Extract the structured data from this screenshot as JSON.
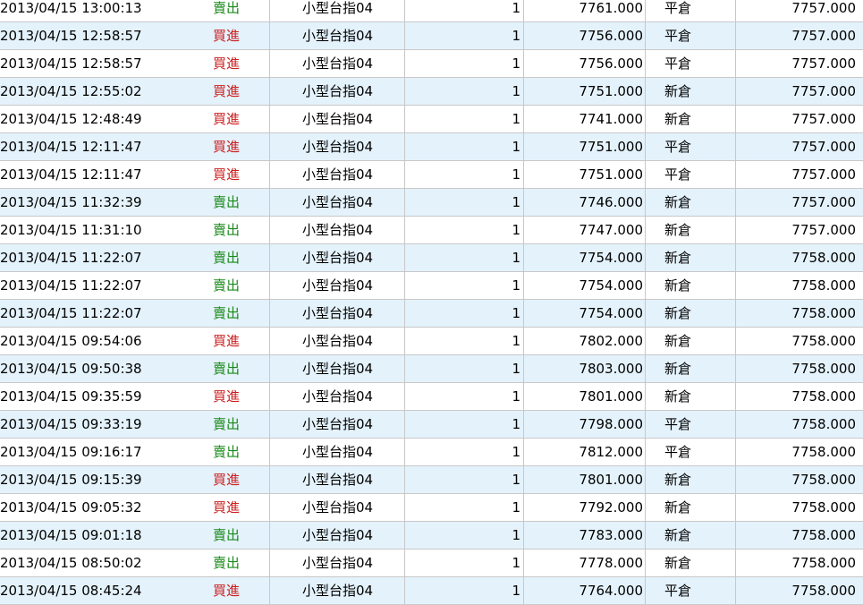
{
  "colors": {
    "sell": "#1a8a1a",
    "buy": "#cc1f1f",
    "alt_row": "#e4f2fb",
    "grid_line": "#c8c8c8"
  },
  "trades": [
    {
      "time": "2013/04/15 13:00:13",
      "side": "賣出",
      "side_type": "sell",
      "product": "小型台指04",
      "qty": "1",
      "price": "7761.000",
      "oc": "平倉",
      "ref": "7757.000"
    },
    {
      "time": "2013/04/15 12:58:57",
      "side": "買進",
      "side_type": "buy",
      "product": "小型台指04",
      "qty": "1",
      "price": "7756.000",
      "oc": "平倉",
      "ref": "7757.000"
    },
    {
      "time": "2013/04/15 12:58:57",
      "side": "買進",
      "side_type": "buy",
      "product": "小型台指04",
      "qty": "1",
      "price": "7756.000",
      "oc": "平倉",
      "ref": "7757.000"
    },
    {
      "time": "2013/04/15 12:55:02",
      "side": "買進",
      "side_type": "buy",
      "product": "小型台指04",
      "qty": "1",
      "price": "7751.000",
      "oc": "新倉",
      "ref": "7757.000"
    },
    {
      "time": "2013/04/15 12:48:49",
      "side": "買進",
      "side_type": "buy",
      "product": "小型台指04",
      "qty": "1",
      "price": "7741.000",
      "oc": "新倉",
      "ref": "7757.000"
    },
    {
      "time": "2013/04/15 12:11:47",
      "side": "買進",
      "side_type": "buy",
      "product": "小型台指04",
      "qty": "1",
      "price": "7751.000",
      "oc": "平倉",
      "ref": "7757.000"
    },
    {
      "time": "2013/04/15 12:11:47",
      "side": "買進",
      "side_type": "buy",
      "product": "小型台指04",
      "qty": "1",
      "price": "7751.000",
      "oc": "平倉",
      "ref": "7757.000"
    },
    {
      "time": "2013/04/15 11:32:39",
      "side": "賣出",
      "side_type": "sell",
      "product": "小型台指04",
      "qty": "1",
      "price": "7746.000",
      "oc": "新倉",
      "ref": "7757.000"
    },
    {
      "time": "2013/04/15 11:31:10",
      "side": "賣出",
      "side_type": "sell",
      "product": "小型台指04",
      "qty": "1",
      "price": "7747.000",
      "oc": "新倉",
      "ref": "7757.000"
    },
    {
      "time": "2013/04/15 11:22:07",
      "side": "賣出",
      "side_type": "sell",
      "product": "小型台指04",
      "qty": "1",
      "price": "7754.000",
      "oc": "新倉",
      "ref": "7758.000"
    },
    {
      "time": "2013/04/15 11:22:07",
      "side": "賣出",
      "side_type": "sell",
      "product": "小型台指04",
      "qty": "1",
      "price": "7754.000",
      "oc": "新倉",
      "ref": "7758.000"
    },
    {
      "time": "2013/04/15 11:22:07",
      "side": "賣出",
      "side_type": "sell",
      "product": "小型台指04",
      "qty": "1",
      "price": "7754.000",
      "oc": "新倉",
      "ref": "7758.000"
    },
    {
      "time": "2013/04/15 09:54:06",
      "side": "買進",
      "side_type": "buy",
      "product": "小型台指04",
      "qty": "1",
      "price": "7802.000",
      "oc": "新倉",
      "ref": "7758.000"
    },
    {
      "time": "2013/04/15 09:50:38",
      "side": "賣出",
      "side_type": "sell",
      "product": "小型台指04",
      "qty": "1",
      "price": "7803.000",
      "oc": "新倉",
      "ref": "7758.000"
    },
    {
      "time": "2013/04/15 09:35:59",
      "side": "買進",
      "side_type": "buy",
      "product": "小型台指04",
      "qty": "1",
      "price": "7801.000",
      "oc": "新倉",
      "ref": "7758.000"
    },
    {
      "time": "2013/04/15 09:33:19",
      "side": "賣出",
      "side_type": "sell",
      "product": "小型台指04",
      "qty": "1",
      "price": "7798.000",
      "oc": "平倉",
      "ref": "7758.000"
    },
    {
      "time": "2013/04/15 09:16:17",
      "side": "賣出",
      "side_type": "sell",
      "product": "小型台指04",
      "qty": "1",
      "price": "7812.000",
      "oc": "平倉",
      "ref": "7758.000"
    },
    {
      "time": "2013/04/15 09:15:39",
      "side": "買進",
      "side_type": "buy",
      "product": "小型台指04",
      "qty": "1",
      "price": "7801.000",
      "oc": "新倉",
      "ref": "7758.000"
    },
    {
      "time": "2013/04/15 09:05:32",
      "side": "買進",
      "side_type": "buy",
      "product": "小型台指04",
      "qty": "1",
      "price": "7792.000",
      "oc": "新倉",
      "ref": "7758.000"
    },
    {
      "time": "2013/04/15 09:01:18",
      "side": "賣出",
      "side_type": "sell",
      "product": "小型台指04",
      "qty": "1",
      "price": "7783.000",
      "oc": "新倉",
      "ref": "7758.000"
    },
    {
      "time": "2013/04/15 08:50:02",
      "side": "賣出",
      "side_type": "sell",
      "product": "小型台指04",
      "qty": "1",
      "price": "7778.000",
      "oc": "新倉",
      "ref": "7758.000"
    },
    {
      "time": "2013/04/15 08:45:24",
      "side": "買進",
      "side_type": "buy",
      "product": "小型台指04",
      "qty": "1",
      "price": "7764.000",
      "oc": "平倉",
      "ref": "7758.000"
    }
  ]
}
